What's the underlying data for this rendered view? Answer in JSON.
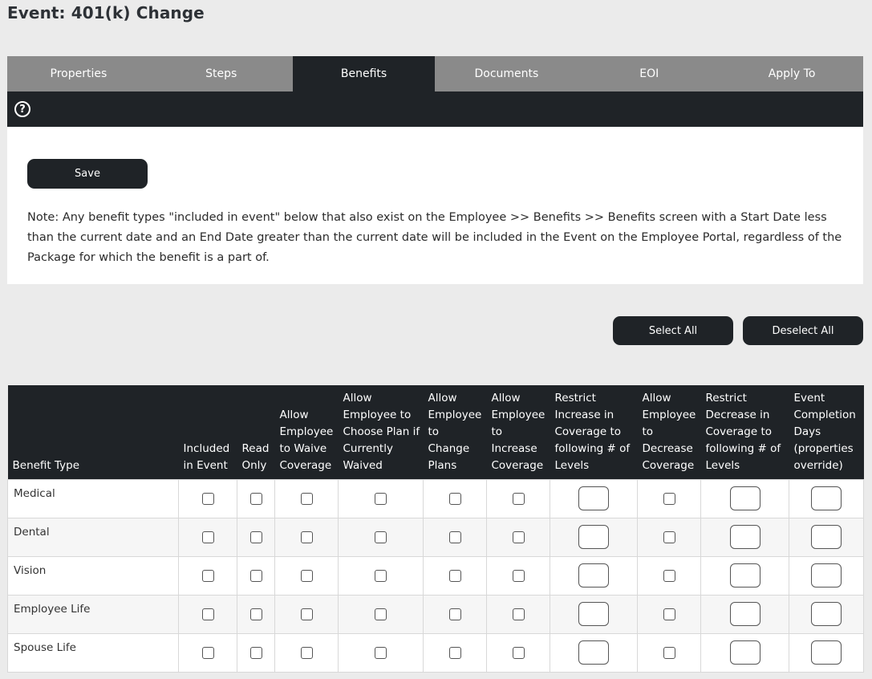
{
  "page_title": "Event: 401(k) Change",
  "tabs": [
    "Properties",
    "Steps",
    "Benefits",
    "Documents",
    "EOI",
    "Apply To"
  ],
  "active_tab": "Benefits",
  "help_icon": "question-circle-icon",
  "save_label": "Save",
  "note": "Note: Any benefit types \"included in event\" below that also exist on the Employee >> Benefits >> Benefits screen with a Start Date less than the current date and an End Date greater than the current date will be included in the Event on the Employee Portal, regardless of the Package for which the benefit is a part of.",
  "select_all_label": "Select All",
  "deselect_all_label": "Deselect All",
  "table": {
    "headers": [
      "Benefit Type",
      "Included in Event",
      "Read Only",
      "Allow Employee to Waive Coverage",
      "Allow Employee to Choose Plan if Currently Waived",
      "Allow Employee to Change Plans",
      "Allow Employee to Increase Coverage",
      "Restrict Increase in Coverage to following # of Levels",
      "Allow Employee to Decrease Coverage",
      "Restrict Decrease in Coverage to following # of Levels",
      "Event Completion Days (properties override)"
    ],
    "rows": [
      {
        "benefit_type": "Medical"
      },
      {
        "benefit_type": "Dental"
      },
      {
        "benefit_type": "Vision"
      },
      {
        "benefit_type": "Employee Life"
      },
      {
        "benefit_type": "Spouse Life"
      }
    ]
  },
  "colors": {
    "dark": "#1f2327",
    "tab_bar": "#8a8a8a",
    "page_bg": "#ebebeb"
  }
}
